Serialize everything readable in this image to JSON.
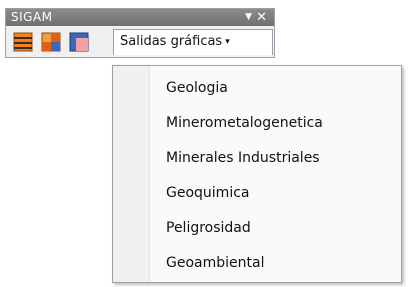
{
  "toolbar": {
    "title": "SIGAM",
    "dropdown_glyph": "▼",
    "close_glyph": "✕",
    "menu_button_label": "Salidas gráficas",
    "menu_button_arrow": "▾",
    "tool_icons": [
      "layers-striped-icon",
      "grid-blocks-icon",
      "map-layer-icon"
    ]
  },
  "menu": {
    "items": [
      {
        "label": "Geologia"
      },
      {
        "label": "Minerometalogenetica"
      },
      {
        "label": "Minerales Industriales"
      },
      {
        "label": "Geoquimica"
      },
      {
        "label": "Peligrosidad"
      },
      {
        "label": "Geoambiental"
      }
    ]
  },
  "colors": {
    "orange": "#f08020",
    "blue": "#3a68c0",
    "pink": "#f0a0a0",
    "titlebar": "#7d7d7d"
  }
}
